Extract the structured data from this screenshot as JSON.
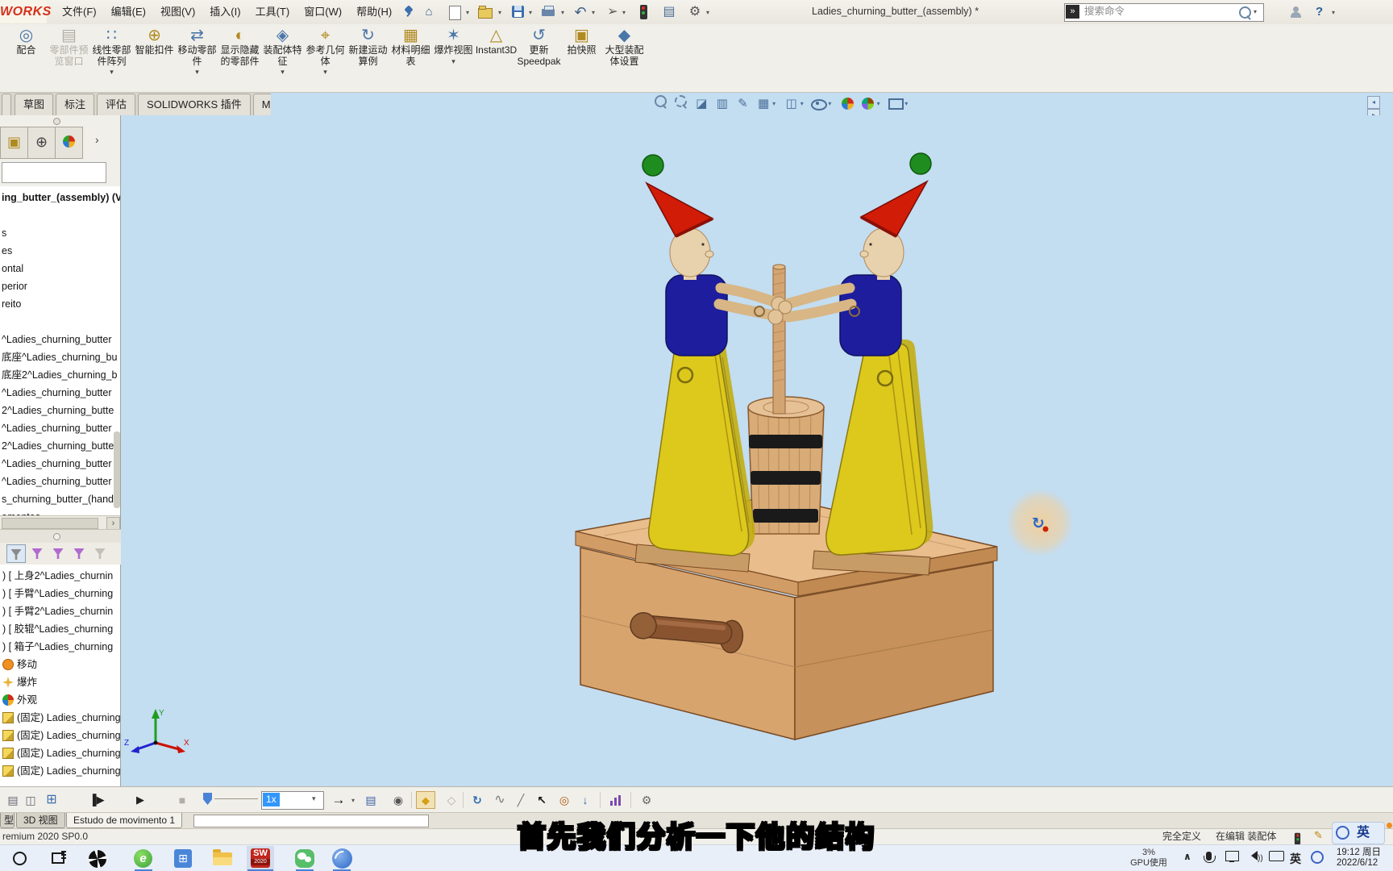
{
  "titlebar": {
    "logo": "WORKS",
    "menus": [
      "文件(F)",
      "编辑(E)",
      "视图(V)",
      "插入(I)",
      "工具(T)",
      "窗口(W)",
      "帮助(H)"
    ],
    "title": "Ladies_churning_butter_(assembly) *",
    "help": "?",
    "search": {
      "placeholder": "搜索命令",
      "icon_glyph": "»"
    }
  },
  "ribbon": {
    "buttons": [
      {
        "label": "配合",
        "glyph": "◎",
        "dd": "",
        "cls": "",
        "name": "mate-button"
      },
      {
        "label": "零部件预览窗口",
        "glyph": "▤",
        "dd": "",
        "cls": "disabled",
        "name": "component-preview-button"
      },
      {
        "label": "线性零部件阵列",
        "glyph": "∷",
        "dd": "▾",
        "cls": "",
        "name": "linear-pattern-button"
      },
      {
        "label": "智能扣件",
        "glyph": "⊕",
        "dd": "",
        "cls": "",
        "name": "smart-fasteners-button"
      },
      {
        "label": "移动零部件",
        "glyph": "⇄",
        "dd": "▾",
        "cls": "",
        "name": "move-component-button"
      },
      {
        "label": "显示隐藏的零部件",
        "glyph": "◐",
        "dd": "",
        "cls": "",
        "name": "show-hidden-components-button"
      },
      {
        "label": "装配体特征",
        "glyph": "◈",
        "dd": "▾",
        "cls": "",
        "name": "assembly-features-button"
      },
      {
        "label": "参考几何体",
        "glyph": "⌖",
        "dd": "▾",
        "cls": "",
        "name": "reference-geometry-button"
      },
      {
        "label": "新建运动算例",
        "glyph": "↻",
        "dd": "",
        "cls": "",
        "name": "new-motion-study-button"
      },
      {
        "label": "材料明细表",
        "glyph": "▦",
        "dd": "",
        "cls": "",
        "name": "bom-button"
      },
      {
        "label": "爆炸视图",
        "glyph": "✶",
        "dd": "▾",
        "cls": "",
        "name": "exploded-view-button"
      },
      {
        "label": "Instant3D",
        "glyph": "△",
        "dd": "",
        "cls": "",
        "name": "instant3d-button"
      },
      {
        "label": "更新 Speedpak",
        "glyph": "↺",
        "dd": "",
        "cls": "",
        "name": "update-speedpak-button"
      },
      {
        "label": "拍快照",
        "glyph": "▣",
        "dd": "",
        "cls": "",
        "name": "take-snapshot-button"
      },
      {
        "label": "大型装配体设置",
        "glyph": "◆",
        "dd": "",
        "cls": "",
        "name": "large-assembly-settings-button"
      }
    ]
  },
  "tabs": {
    "items": [
      "草图",
      "标注",
      "评估",
      "SOLIDWORKS 插件",
      "MBD"
    ]
  },
  "feature_tree": {
    "header": "ing_butter_(assembly)  (V",
    "items": [
      {
        "t": ""
      },
      {
        "t": "s"
      },
      {
        "t": "es"
      },
      {
        "t": "ontal"
      },
      {
        "t": "perior"
      },
      {
        "t": "reito"
      },
      {
        "t": ""
      },
      {
        "t": "^Ladies_churning_butter"
      },
      {
        "t": "底座^Ladies_churning_bu"
      },
      {
        "t": "底座2^Ladies_churning_b"
      },
      {
        "t": "^Ladies_churning_butter"
      },
      {
        "t": "2^Ladies_churning_butte"
      },
      {
        "t": "^Ladies_churning_butter"
      },
      {
        "t": "2^Ladies_churning_butte"
      },
      {
        "t": "^Ladies_churning_butter"
      },
      {
        "t": "^Ladies_churning_butter"
      },
      {
        "t": "s_churning_butter_(hand_"
      },
      {
        "t": "amentos"
      }
    ]
  },
  "motion_tree": {
    "items": [
      {
        "t": ") [ 上身2^Ladies_churnin",
        "ic": "none"
      },
      {
        "t": ") [ 手臂^Ladies_churning",
        "ic": "none"
      },
      {
        "t": ") [ 手臂2^Ladies_churnin",
        "ic": "none"
      },
      {
        "t": ") [ 胶辊^Ladies_churning",
        "ic": "none"
      },
      {
        "t": ") [ 箱子^Ladies_churning",
        "ic": "none"
      },
      {
        "t": "移动",
        "ic": "move"
      },
      {
        "t": "爆炸",
        "ic": "explode"
      },
      {
        "t": "外观",
        "ic": "appearance"
      },
      {
        "t": "(固定) Ladies_churning_",
        "ic": "cube"
      },
      {
        "t": "(固定) Ladies_churning_",
        "ic": "cube"
      },
      {
        "t": "(固定) Ladies_churning_",
        "ic": "cube"
      },
      {
        "t": "(固定) Ladies_churning_",
        "ic": "cube"
      }
    ]
  },
  "motionbar": {
    "speed": "1x"
  },
  "bottom_tabs": {
    "stub": "型",
    "tab_3d": "3D 视图",
    "tab_motion": "Estudo de movimento 1"
  },
  "statusbar": {
    "left": "remium 2020 SP0.0",
    "defined": "完全定义",
    "editing": "在编辑 装配体"
  },
  "subtitle": {
    "text": "首先我们分析一下他的结构"
  },
  "taskbar": {
    "gpu_pct": "3%",
    "gpu_label": "GPU使用",
    "hidden_caret": "∧",
    "ime": "英",
    "time": "19:12 周日",
    "date": "2022/6/12",
    "sw_abbr": "SW",
    "sw_year": "2020",
    "green_browser_glyph": "e",
    "calc_glyph": "⊞"
  },
  "ime_float": {
    "label": "英"
  },
  "viewport": {
    "triad": {
      "x": "X",
      "y": "Y",
      "z": "Z"
    },
    "rotate_glyph": "↻"
  },
  "colors": {
    "viewport_bg": "#c3ddf1",
    "accent_blue": "#3297fd",
    "wood": "#d8a46e",
    "skirt_yellow": "#ddc81c",
    "torso_blue": "#1d1d9e",
    "hat_red": "#d11c08"
  }
}
